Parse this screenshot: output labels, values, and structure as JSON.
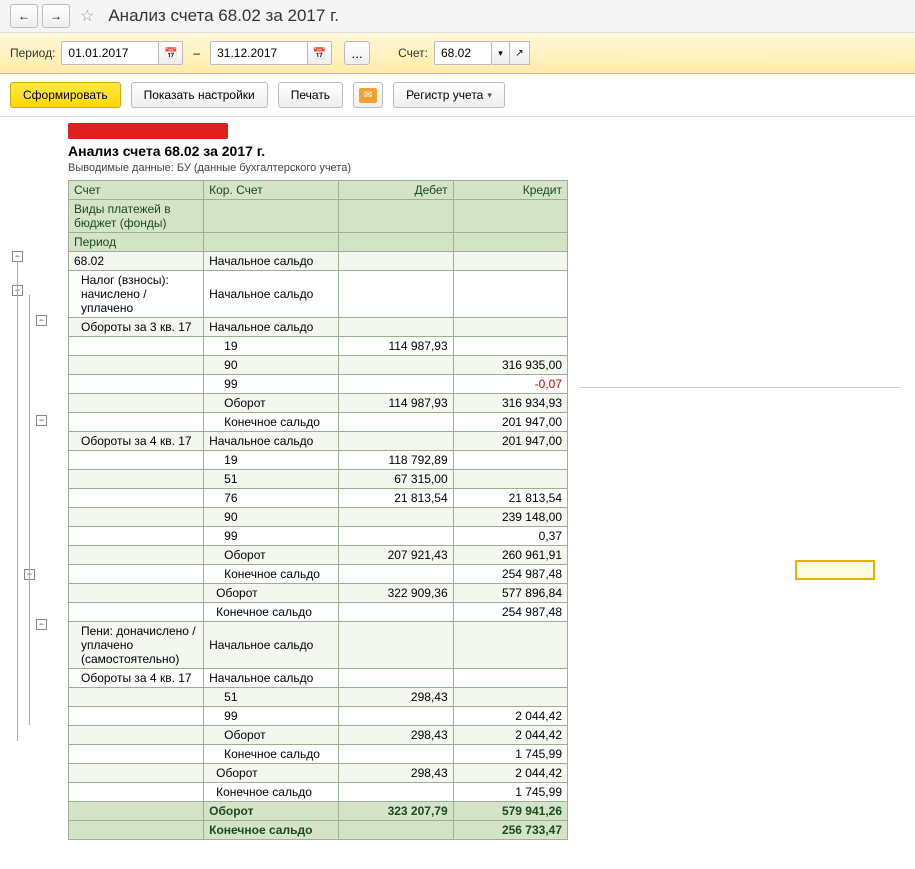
{
  "header": {
    "title": "Анализ счета 68.02 за 2017 г."
  },
  "filter": {
    "period_label": "Период:",
    "date_from": "01.01.2017",
    "date_to": "31.12.2017",
    "dash": "–",
    "dots": "...",
    "account_label": "Счет:",
    "account_value": "68.02"
  },
  "actions": {
    "form": "Сформировать",
    "settings": "Показать настройки",
    "print": "Печать",
    "register": "Регистр учета"
  },
  "report": {
    "title": "Анализ счета 68.02 за 2017 г.",
    "subtitle": "Выводимые данные:  БУ (данные бухгалтерского учета)",
    "headers": {
      "acct": "Счет",
      "kor": "Кор. Счет",
      "debit": "Дебет",
      "credit": "Кредит"
    },
    "subheaders": {
      "types": "Виды платежей в бюджет (фонды)",
      "period": "Период"
    },
    "rows": [
      {
        "a": "68.02",
        "k": "Начальное сальдо",
        "d": "",
        "c": "",
        "cls": "striped"
      },
      {
        "a": "Налог (взносы): начислено / уплачено",
        "k": "Начальное сальдо",
        "d": "",
        "c": "",
        "ind": 1
      },
      {
        "a": "Обороты за 3 кв. 17",
        "k": "Начальное сальдо",
        "d": "",
        "c": "",
        "ind": 1,
        "cls": "striped"
      },
      {
        "a": "",
        "k": "19",
        "d": "114 987,93",
        "c": "",
        "kind": 2
      },
      {
        "a": "",
        "k": "90",
        "d": "",
        "c": "316 935,00",
        "kind": 2,
        "cls": "striped"
      },
      {
        "a": "",
        "k": "99",
        "d": "",
        "c": "-0,07",
        "kind": 2,
        "neg": true
      },
      {
        "a": "",
        "k": "Оборот",
        "d": "114 987,93",
        "c": "316 934,93",
        "kind": 2,
        "cls": "striped"
      },
      {
        "a": "",
        "k": "Конечное сальдо",
        "d": "",
        "c": "201 947,00",
        "kind": 2
      },
      {
        "a": "Обороты за 4 кв. 17",
        "k": "Начальное сальдо",
        "d": "",
        "c": "201 947,00",
        "ind": 1,
        "cls": "striped"
      },
      {
        "a": "",
        "k": "19",
        "d": "118 792,89",
        "c": "",
        "kind": 2
      },
      {
        "a": "",
        "k": "51",
        "d": "67 315,00",
        "c": "",
        "kind": 2,
        "cls": "striped"
      },
      {
        "a": "",
        "k": "76",
        "d": "21 813,54",
        "c": "21 813,54",
        "kind": 2
      },
      {
        "a": "",
        "k": "90",
        "d": "",
        "c": "239 148,00",
        "kind": 2,
        "cls": "striped"
      },
      {
        "a": "",
        "k": "99",
        "d": "",
        "c": "0,37",
        "kind": 2
      },
      {
        "a": "",
        "k": "Оборот",
        "d": "207 921,43",
        "c": "260 961,91",
        "kind": 2,
        "cls": "striped"
      },
      {
        "a": "",
        "k": "Конечное сальдо",
        "d": "",
        "c": "254 987,48",
        "kind": 2
      },
      {
        "a": "",
        "k": "Оборот",
        "d": "322 909,36",
        "c": "577 896,84",
        "kind": 1,
        "cls": "striped"
      },
      {
        "a": "",
        "k": "Конечное сальдо",
        "d": "",
        "c": "254 987,48",
        "kind": 1
      },
      {
        "a": "Пени: доначислено / уплачено (самостоятельно)",
        "k": "Начальное сальдо",
        "d": "",
        "c": "",
        "ind": 1,
        "cls": "striped"
      },
      {
        "a": "Обороты за 4 кв. 17",
        "k": "Начальное сальдо",
        "d": "",
        "c": "",
        "ind": 1
      },
      {
        "a": "",
        "k": "51",
        "d": "298,43",
        "c": "",
        "kind": 2,
        "cls": "striped"
      },
      {
        "a": "",
        "k": "99",
        "d": "",
        "c": "2 044,42",
        "kind": 2
      },
      {
        "a": "",
        "k": "Оборот",
        "d": "298,43",
        "c": "2 044,42",
        "kind": 2,
        "cls": "striped"
      },
      {
        "a": "",
        "k": "Конечное сальдо",
        "d": "",
        "c": "1 745,99",
        "kind": 2
      },
      {
        "a": "",
        "k": "Оборот",
        "d": "298,43",
        "c": "2 044,42",
        "kind": 1,
        "cls": "striped"
      },
      {
        "a": "",
        "k": "Конечное сальдо",
        "d": "",
        "c": "1 745,99",
        "kind": 1
      }
    ],
    "totals": [
      {
        "k": "Оборот",
        "d": "323 207,79",
        "c": "579 941,26"
      },
      {
        "k": "Конечное сальдо",
        "d": "",
        "c": "256 733,47"
      }
    ]
  }
}
